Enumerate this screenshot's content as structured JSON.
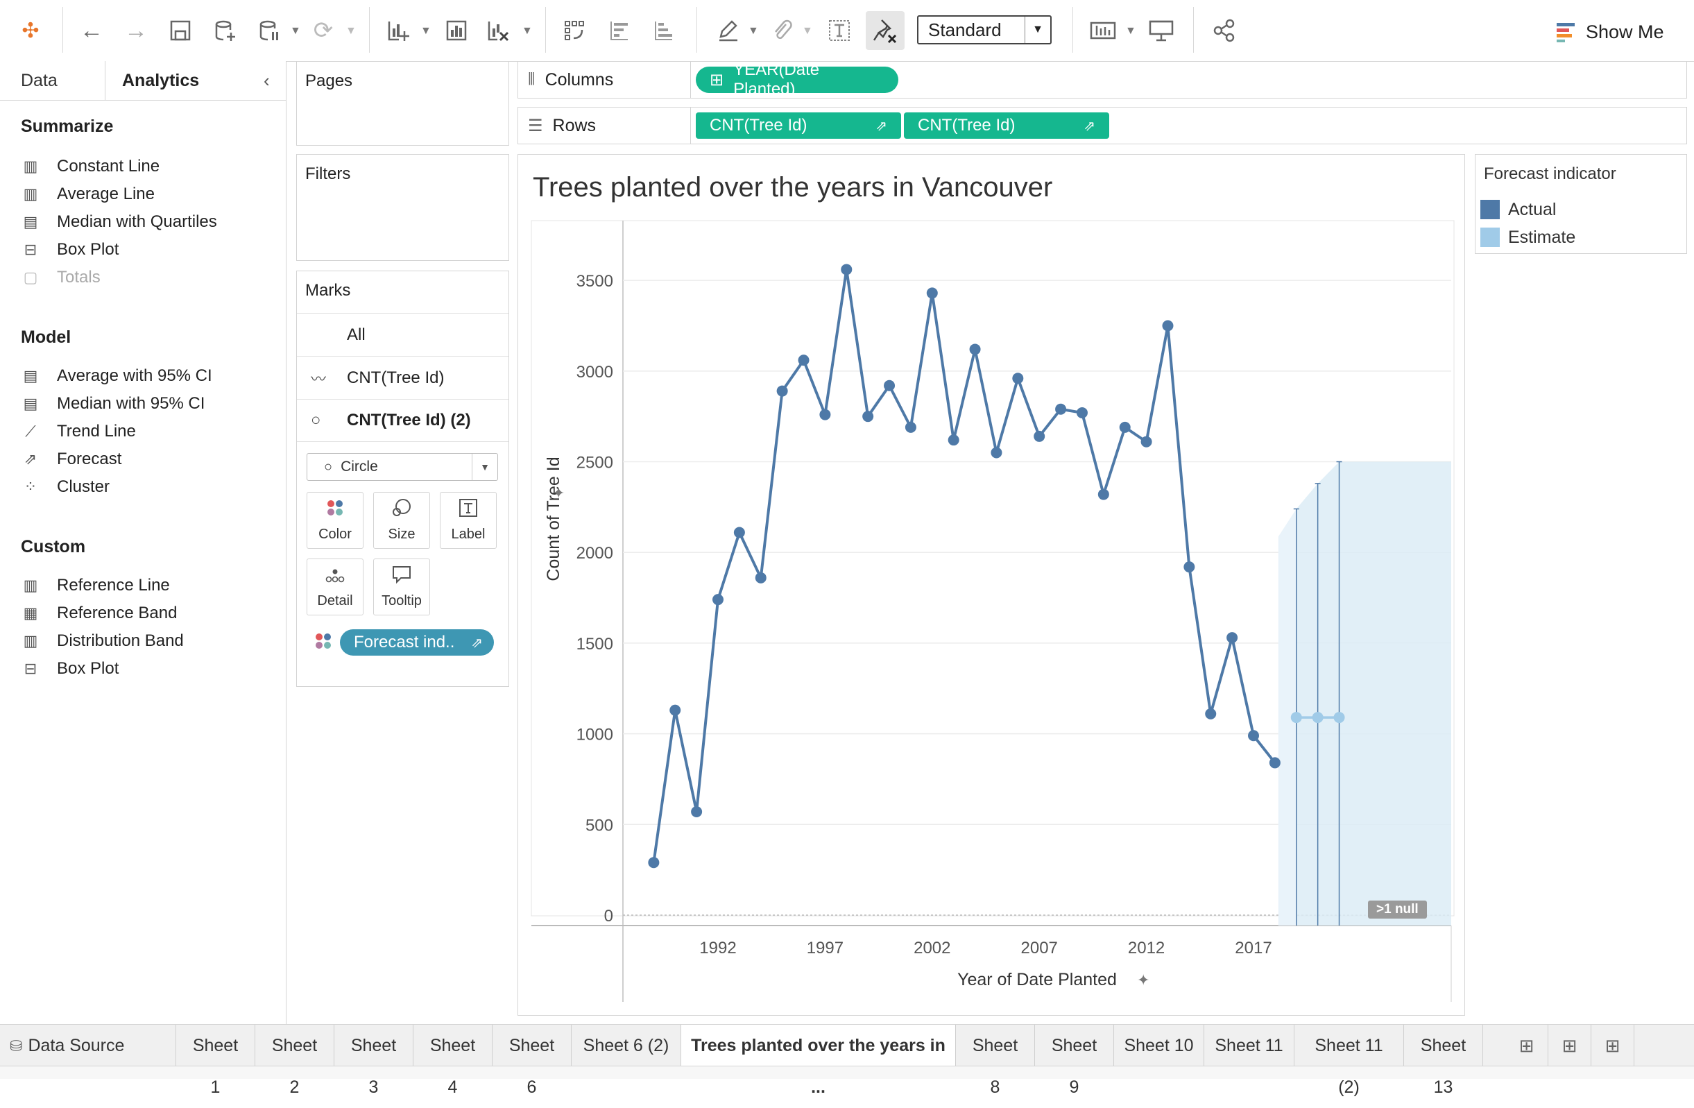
{
  "toolbar": {
    "view_size": "Standard",
    "show_me": "Show Me"
  },
  "left_panel": {
    "tabs": [
      "Data",
      "Analytics"
    ],
    "summarize": {
      "title": "Summarize",
      "items": [
        {
          "label": "Constant Line",
          "icon": "constant-line-icon",
          "enabled": true
        },
        {
          "label": "Average Line",
          "icon": "average-line-icon",
          "enabled": true
        },
        {
          "label": "Median with Quartiles",
          "icon": "median-quartiles-icon",
          "enabled": true
        },
        {
          "label": "Box Plot",
          "icon": "box-plot-icon",
          "enabled": true
        },
        {
          "label": "Totals",
          "icon": "totals-icon",
          "enabled": false
        }
      ]
    },
    "model": {
      "title": "Model",
      "items": [
        {
          "label": "Average with 95% CI",
          "icon": "average-ci-icon"
        },
        {
          "label": "Median with 95% CI",
          "icon": "median-ci-icon"
        },
        {
          "label": "Trend Line",
          "icon": "trend-line-icon"
        },
        {
          "label": "Forecast",
          "icon": "forecast-icon"
        },
        {
          "label": "Cluster",
          "icon": "cluster-icon"
        }
      ]
    },
    "custom": {
      "title": "Custom",
      "items": [
        {
          "label": "Reference Line",
          "icon": "reference-line-icon"
        },
        {
          "label": "Reference Band",
          "icon": "reference-band-icon"
        },
        {
          "label": "Distribution Band",
          "icon": "distribution-band-icon"
        },
        {
          "label": "Box Plot",
          "icon": "box-plot-icon"
        }
      ]
    }
  },
  "cards": {
    "pages": "Pages",
    "filters": "Filters",
    "marks": {
      "title": "Marks",
      "rows": [
        "All",
        "CNT(Tree Id)",
        "CNT(Tree Id) (2)"
      ],
      "mark_type": "Circle",
      "buttons": [
        "Color",
        "Size",
        "Label",
        "Detail",
        "Tooltip"
      ],
      "color_pill": "Forecast ind.."
    }
  },
  "shelves": {
    "columns_label": "Columns",
    "rows_label": "Rows",
    "columns_pill": "YEAR(Date Planted)",
    "rows_pills": [
      "CNT(Tree Id)",
      "CNT(Tree Id)"
    ]
  },
  "legend": {
    "title": "Forecast indicator",
    "items": [
      {
        "label": "Actual",
        "color": "#4e79a7"
      },
      {
        "label": "Estimate",
        "color": "#a0cbe8"
      }
    ]
  },
  "null_badge": ">1 null",
  "chart_data": {
    "type": "line",
    "title": "Trees planted over the years in Vancouver",
    "xlabel": "Year of Date Planted",
    "ylabel": "Count of Tree Id",
    "x_ticks": [
      1992,
      1997,
      2002,
      2007,
      2012,
      2017
    ],
    "y_ticks": [
      0,
      500,
      1000,
      1500,
      2000,
      2500,
      3000,
      3500
    ],
    "ylim": [
      0,
      3600
    ],
    "xlim": [
      1987.3,
      2021.0
    ],
    "series": [
      {
        "name": "Actual",
        "color": "#4e79a7",
        "x": [
          1989,
          1990,
          1991,
          1992,
          1993,
          1994,
          1995,
          1996,
          1997,
          1998,
          1999,
          2000,
          2001,
          2002,
          2003,
          2004,
          2005,
          2006,
          2007,
          2008,
          2009,
          2010,
          2011,
          2012,
          2013,
          2014,
          2015,
          2016,
          2017,
          2018
        ],
        "values": [
          290,
          1130,
          570,
          1740,
          2110,
          1860,
          2890,
          3060,
          2760,
          3560,
          2750,
          2920,
          2690,
          3430,
          2620,
          3120,
          2550,
          2960,
          2640,
          2790,
          2770,
          2320,
          2690,
          2610,
          3250,
          1920,
          1110,
          1530,
          990,
          840
        ]
      },
      {
        "name": "Estimate",
        "color": "#a0cbe8",
        "x": [
          2019,
          2020,
          2021
        ],
        "values": [
          1090,
          1090,
          1090
        ],
        "upper": [
          2240,
          2380,
          2500
        ],
        "lower": [
          0,
          0,
          0
        ]
      }
    ],
    "grid": true,
    "legend_position": "right"
  },
  "sheet_tabs": {
    "data_source": "Data Source",
    "tabs": [
      "Sheet 1",
      "Sheet 2",
      "Sheet 3",
      "Sheet 4",
      "Sheet 6",
      "Sheet 6 (2)",
      "Trees planted over the years in ...",
      "Sheet 8",
      "Sheet 9",
      "Sheet 10",
      "Sheet 11",
      "Sheet 11 (2)",
      "Sheet 13"
    ],
    "active_index": 6
  }
}
